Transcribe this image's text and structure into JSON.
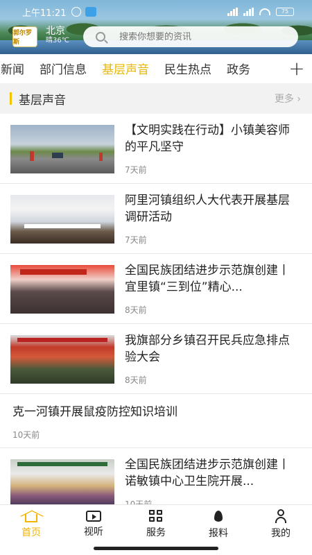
{
  "status_bar": {
    "time": "上午11:21",
    "battery": "75"
  },
  "header": {
    "logo_text": "郭尔罗斯",
    "city": "北京",
    "weather": "晴36℃",
    "search_placeholder": "搜索你想要的资讯"
  },
  "tabs": [
    {
      "label": "新闻",
      "active": false
    },
    {
      "label": "部门信息",
      "active": false
    },
    {
      "label": "基层声音",
      "active": true
    },
    {
      "label": "民生热点",
      "active": false
    },
    {
      "label": "政务",
      "active": false
    }
  ],
  "section": {
    "title": "基层声音",
    "more": "更多 ›"
  },
  "articles": [
    {
      "title": "【文明实践在行动】小镇美容师的平凡坚守",
      "time": "7天前",
      "has_image": true
    },
    {
      "title": "阿里河镇组织人大代表开展基层调研活动",
      "time": "7天前",
      "has_image": true
    },
    {
      "title": "全国民族团结进步示范旗创建丨宜里镇“三到位”精心...",
      "time": "8天前",
      "has_image": true
    },
    {
      "title": "我旗部分乡镇召开民兵应急排点验大会",
      "time": "8天前",
      "has_image": true
    },
    {
      "title": "克一河镇开展鼠疫防控知识培训",
      "time": "10天前",
      "has_image": false
    },
    {
      "title": "全国民族团结进步示范旗创建丨诺敏镇中心卫生院开展...",
      "time": "10天前",
      "has_image": true
    }
  ],
  "bottom_nav": [
    {
      "label": "首页",
      "icon": "home-icon",
      "active": true
    },
    {
      "label": "视听",
      "icon": "tv-icon",
      "active": false
    },
    {
      "label": "服务",
      "icon": "grid-icon",
      "active": false
    },
    {
      "label": "报料",
      "icon": "fire-icon",
      "active": false
    },
    {
      "label": "我的",
      "icon": "user-icon",
      "active": false
    }
  ],
  "colors": {
    "accent": "#f4c400",
    "active_text": "#e8b800"
  }
}
